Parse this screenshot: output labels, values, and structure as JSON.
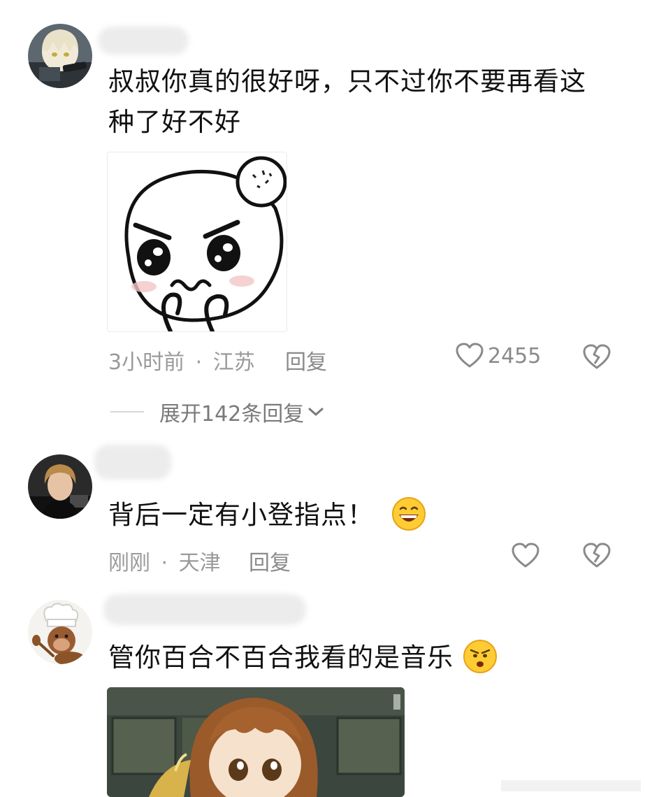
{
  "comments": [
    {
      "text_line1": "叔叔你真的很好呀，只不过你不要再看这",
      "text_line2": "种了好不好",
      "time": "3小时前",
      "separator": "·",
      "location": "江苏",
      "reply_label": "回复",
      "like_count": "2455",
      "sticker": "angry-cartoon-sticker",
      "avatar": "anime-character-avatar"
    },
    {
      "text": "背后一定有小登指点！",
      "emoji": "grinning-sweat-emoji",
      "time": "刚刚",
      "separator": "·",
      "location": "天津",
      "reply_label": "回复",
      "like_count": "",
      "avatar": "person-photo-avatar"
    },
    {
      "text": "管你百合不百合我看的是音乐",
      "emoji": "smirk-face-emoji",
      "avatar": "chef-monkey-avatar",
      "image": "anime-girl-screenshot"
    }
  ],
  "expand_replies_label": "展开142条回复",
  "colors": {
    "meta_gray": "#9a9a9a",
    "icon_gray": "#8a8a8a",
    "text": "#111111",
    "background": "#ffffff"
  }
}
